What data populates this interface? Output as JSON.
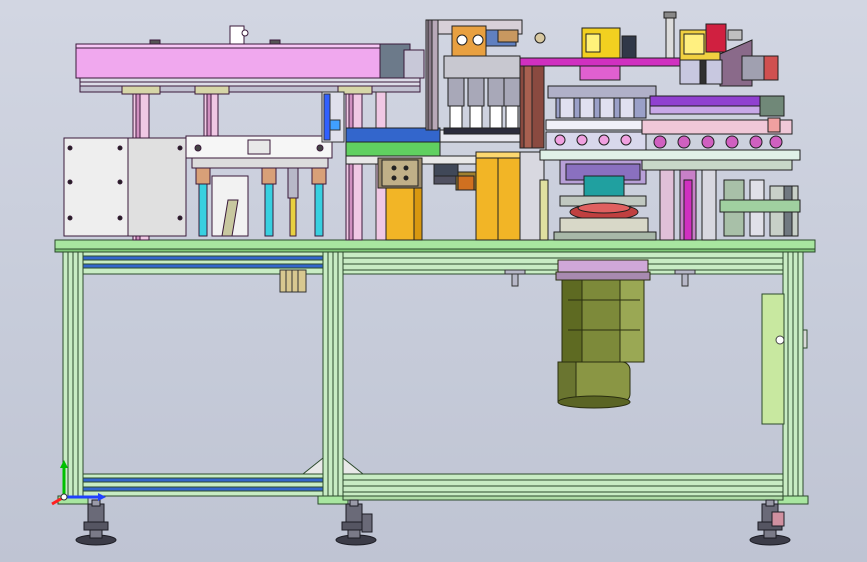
{
  "view": {
    "type": "cad-assembly-front-view",
    "background": "#c9cedb",
    "triad_axes": [
      "x",
      "y",
      "z"
    ]
  },
  "colors": {
    "frame_profile": "#c8ecc4",
    "frame_edge": "#2c4a2c",
    "blue_rail": "#3366cc",
    "pink_housing": "#f0a8ee",
    "yellow_block": "#f2b526",
    "motor_olive": "#7d8a3a",
    "cyan_rod": "#38d0e0",
    "magenta_part": "#d030c0",
    "panel_grey": "#e6e6e6",
    "machine_base": "#a8e6a0",
    "cabinet_door": "#c8e8a0",
    "foot_dark": "#3c3c48"
  },
  "icons": {
    "triad": "xyz-axis-triad-icon",
    "door_handle": "door-handle-icon"
  }
}
